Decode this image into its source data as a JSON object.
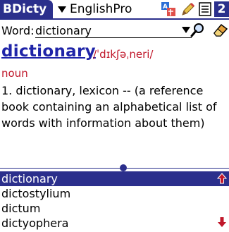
{
  "titlebar": {
    "app_name": "BDicty",
    "dictionary": "EnglishPro",
    "page": "2",
    "icons": [
      "translate-icon",
      "pencil-icon",
      "document-icon"
    ]
  },
  "search": {
    "label": "Word:",
    "value": "dictionary"
  },
  "entry": {
    "headword": "dictionary",
    "phonetic": "/ˈdɪkʃəˌneri/",
    "part_of_speech": "noun",
    "definition": "1. dictionary, lexicon -- (a reference book containing an alphabetical list of words with information about them)"
  },
  "word_list": [
    "dictionary",
    "dictostylium",
    "dictum",
    "dictyophera"
  ],
  "selected_index": 0,
  "colors": {
    "accent": "#2b2f8c",
    "headword": "#1f24a8",
    "phonetic": "#c0172a",
    "arrow": "#c0172a"
  }
}
